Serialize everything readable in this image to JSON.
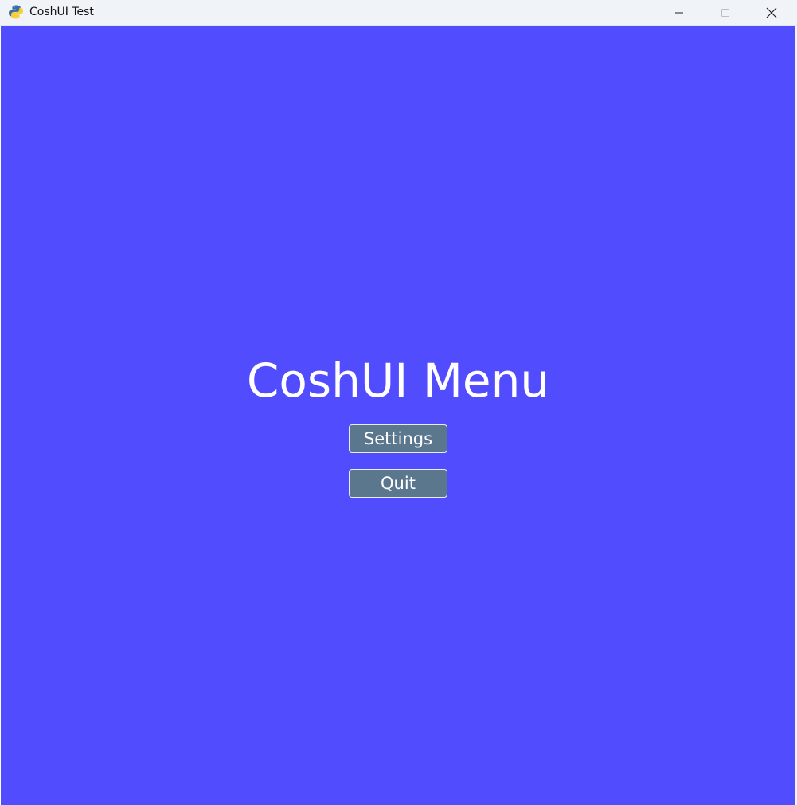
{
  "window": {
    "title": "CoshUI Test",
    "icon": "python-logo-icon",
    "controls": [
      "minimize-icon",
      "maximize-icon",
      "close-icon"
    ]
  },
  "menu": {
    "title": "CoshUI Menu",
    "buttons": [
      {
        "label": "Settings"
      },
      {
        "label": "Quit"
      }
    ]
  },
  "colors": {
    "background": "#524cff",
    "button_fill": "#5a778e",
    "button_border": "#e8eef4",
    "text": "#ffffff",
    "titlebar": "#f0f3f7"
  }
}
